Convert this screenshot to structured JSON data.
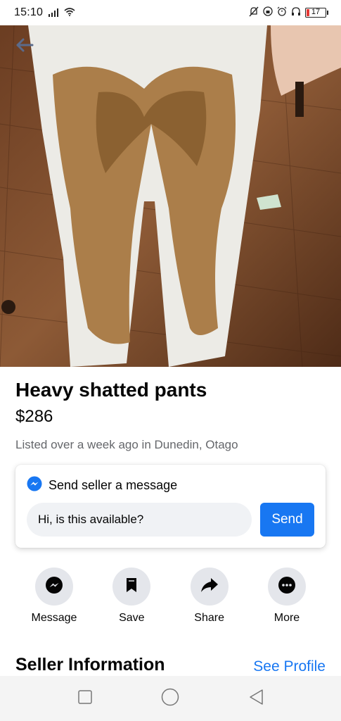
{
  "status_bar": {
    "time": "15:10",
    "battery": "17"
  },
  "listing": {
    "title": "Heavy shatted pants",
    "price": "$286",
    "meta": "Listed over a week ago in Dunedin, Otago"
  },
  "message_card": {
    "header": "Send seller a message",
    "input_value": "Hi, is this available?",
    "send_label": "Send"
  },
  "actions": [
    {
      "label": "Message",
      "icon": "messenger-icon"
    },
    {
      "label": "Save",
      "icon": "bookmark-icon"
    },
    {
      "label": "Share",
      "icon": "share-icon"
    },
    {
      "label": "More",
      "icon": "more-icon"
    }
  ],
  "seller": {
    "heading": "Seller Information",
    "link": "See Profile"
  },
  "colors": {
    "accent": "#1877f2",
    "button_bg": "#e4e6eb",
    "secondary_text": "#65676b"
  }
}
